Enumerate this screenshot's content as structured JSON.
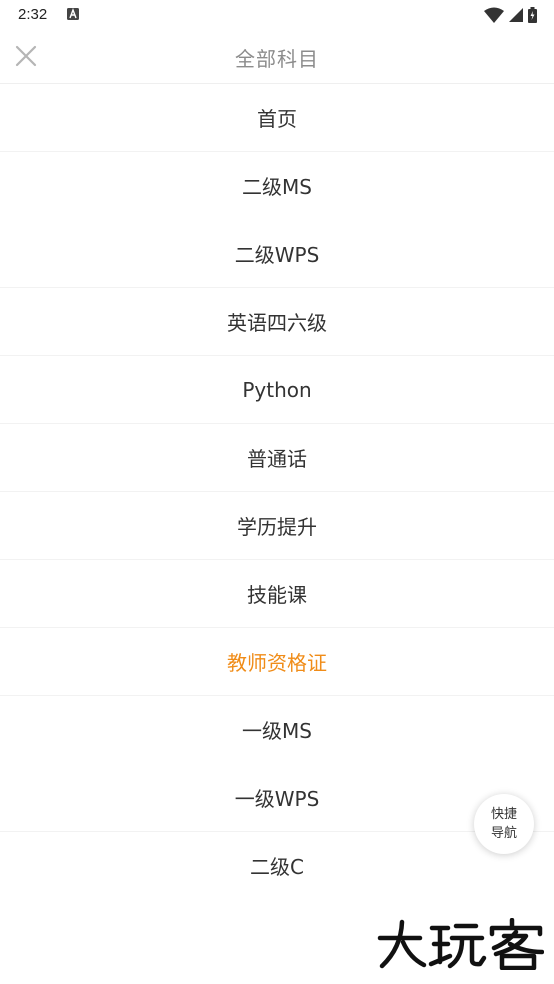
{
  "status_bar": {
    "time": "2:32",
    "icons": [
      "a-notification-icon",
      "wifi-icon",
      "signal-icon",
      "battery-icon"
    ]
  },
  "header": {
    "title": "全部科目",
    "close_icon": "close-icon"
  },
  "nav": {
    "items": [
      {
        "label": "首页"
      },
      {
        "label": "二级MS"
      },
      {
        "label": "二级WPS"
      },
      {
        "label": "英语四六级"
      },
      {
        "label": "Python"
      },
      {
        "label": "普通话"
      },
      {
        "label": "学历提升"
      },
      {
        "label": "技能课"
      },
      {
        "label": "教师资格证",
        "active": true
      },
      {
        "label": "一级MS"
      },
      {
        "label": "一级WPS"
      },
      {
        "label": "二级C"
      }
    ]
  },
  "quick_nav": {
    "line1": "快捷",
    "line2": "导航"
  },
  "watermark": {
    "text": "大玩客"
  },
  "colors": {
    "active": "#f08c18",
    "text": "#333333",
    "title": "#8c8c8c",
    "divider": "#f2f2f2"
  }
}
